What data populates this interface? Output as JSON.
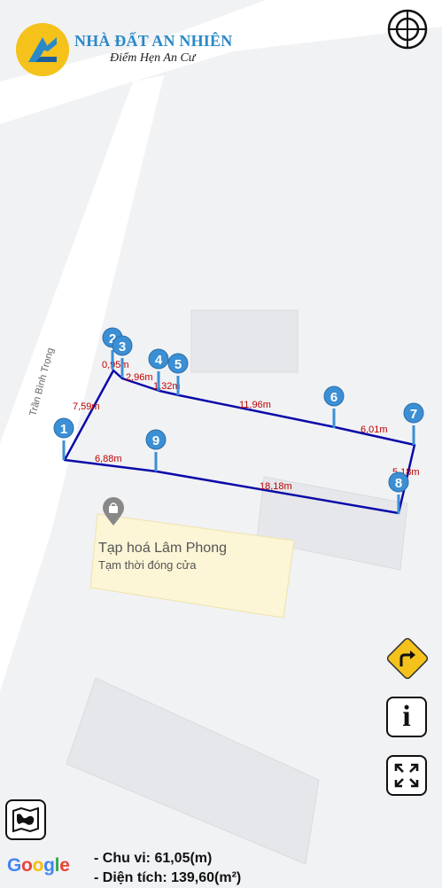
{
  "brand": {
    "name": "NHÀ ĐẤT AN NHIÊN",
    "slogan": "Điểm Hẹn An Cư",
    "colors": {
      "blue": "#2a89c8",
      "yellow": "#f4c21b"
    }
  },
  "map": {
    "street_label": "Trần Bình Trọng",
    "poi": {
      "name": "Tạp hoá Lâm Phong",
      "status": "Tạm thời đóng cửa",
      "icon": "shopping-bag-icon"
    },
    "boundary_color": "#0a0aa8",
    "marker_color": "#3b8fd4",
    "length_label_color": "#c00000",
    "markers": [
      "1",
      "2",
      "3",
      "4",
      "5",
      "6",
      "7",
      "8",
      "9"
    ],
    "edge_lengths": [
      "7,59m",
      "0,95m",
      "2,96m",
      "1,32m",
      "11,96m",
      "6,01m",
      "5,18m",
      "18,18m",
      "6,88m"
    ]
  },
  "controls": {
    "locate": "crosshair-icon",
    "directions": "turn-right-sign-icon",
    "info": "i",
    "fullscreen": "expand-icon",
    "map_type": "map-icon"
  },
  "attribution": {
    "google": [
      "G",
      "o",
      "o",
      "g",
      "l",
      "e"
    ]
  },
  "stats": {
    "perimeter": "- Chu vi: 61,05(m)",
    "area": "- Diện tích: 139,60(m²)"
  }
}
